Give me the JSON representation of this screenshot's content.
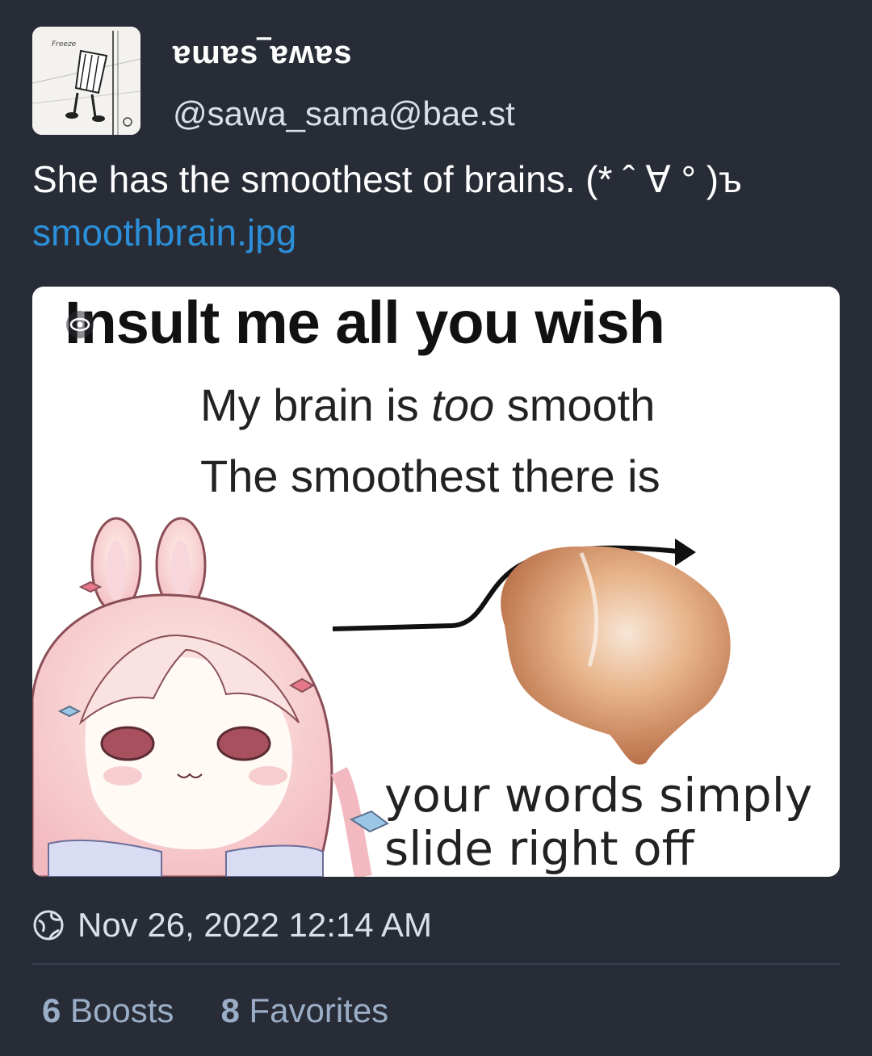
{
  "post": {
    "display_name": "ɐɯɐs‾ɐʍɐs",
    "handle": "@sawa_sama@bae.st",
    "text": "She has the smoothest of brains. (* ˆ ∀ ° )ъ",
    "attachment_link": "smoothbrain.jpg",
    "timestamp": "Nov 26, 2022 12:14 AM",
    "visibility_icon": "globe-icon",
    "boosts_count": "6",
    "boosts_label": "Boosts",
    "favorites_count": "8",
    "favorites_label": "Favorites"
  },
  "avatar": {
    "caption": "Freeze"
  },
  "media": {
    "title": "Insult me all you wish",
    "line1_a": "My brain is ",
    "line1_b": "too",
    "line1_c": " smooth",
    "line2": "The smoothest there is",
    "line3": "your words simply",
    "line4": "slide right off",
    "hide_icon": "eye-icon"
  },
  "colors": {
    "background": "#282c37",
    "link": "#2b90d9",
    "muted": "#9baec8",
    "divider": "#393f4f"
  }
}
